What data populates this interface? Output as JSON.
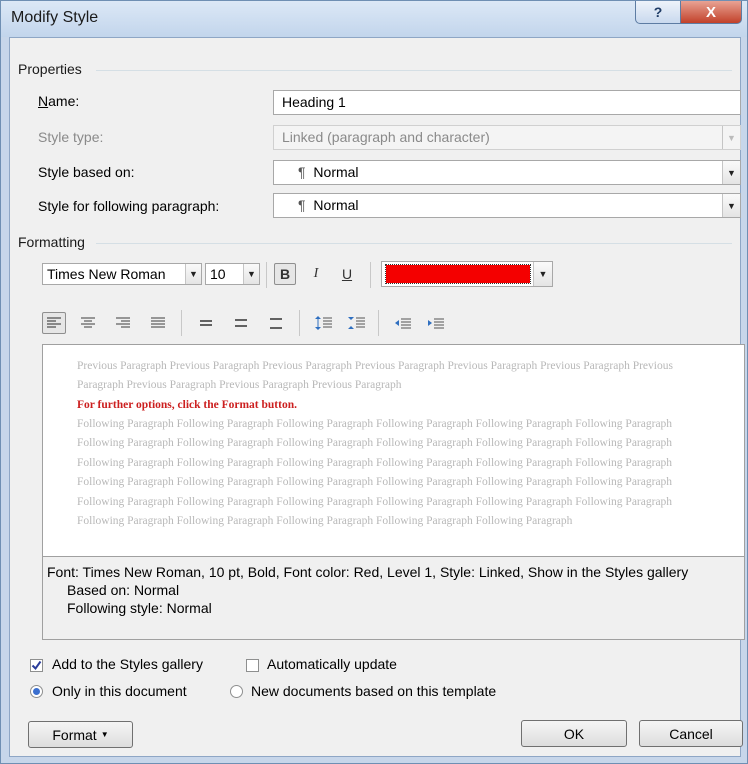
{
  "window": {
    "title": "Modify Style",
    "help_glyph": "?",
    "close_glyph": "X"
  },
  "properties": {
    "section_label": "Properties",
    "name_label": "Name:",
    "name_value": "Heading 1",
    "style_type_label": "Style type:",
    "style_type_value": "Linked (paragraph and character)",
    "based_on_label": "Style based on:",
    "based_on_value": "Normal",
    "following_label": "Style for following paragraph:",
    "following_value": "Normal",
    "paragraph_mark": "¶"
  },
  "formatting": {
    "section_label": "Formatting",
    "font_name": "Times New Roman",
    "font_size": "10",
    "bold": "B",
    "italic": "I",
    "underline": "U",
    "font_color": "#f40000"
  },
  "preview": {
    "previous_paragraph": "Previous Paragraph Previous Paragraph Previous Paragraph Previous Paragraph Previous Paragraph Previous Paragraph Previous Paragraph Previous Paragraph Previous Paragraph Previous Paragraph",
    "current_paragraph": "For further options, click the Format button.",
    "following_paragraph": "Following Paragraph Following Paragraph Following Paragraph Following Paragraph Following Paragraph Following Paragraph Following Paragraph Following Paragraph Following Paragraph Following Paragraph Following Paragraph Following Paragraph Following Paragraph Following Paragraph Following Paragraph Following Paragraph Following Paragraph Following Paragraph Following Paragraph Following Paragraph Following Paragraph Following Paragraph Following Paragraph Following Paragraph Following Paragraph Following Paragraph Following Paragraph Following Paragraph Following Paragraph Following Paragraph Following Paragraph Following Paragraph Following Paragraph Following Paragraph Following Paragraph"
  },
  "description": {
    "line1": "Font: Times New Roman, 10 pt, Bold, Font color: Red, Level 1, Style: Linked, Show in the Styles gallery",
    "line2": "Based on: Normal",
    "line3": "Following style: Normal"
  },
  "options": {
    "add_to_gallery_label": "Add to the Styles gallery",
    "add_to_gallery_checked": true,
    "auto_update_label": "Automatically update",
    "auto_update_checked": false,
    "only_this_doc_label": "Only in this document",
    "new_docs_label": "New documents based on this template",
    "selected_scope": "Only in this document"
  },
  "buttons": {
    "format": "Format",
    "ok": "OK",
    "cancel": "Cancel"
  }
}
